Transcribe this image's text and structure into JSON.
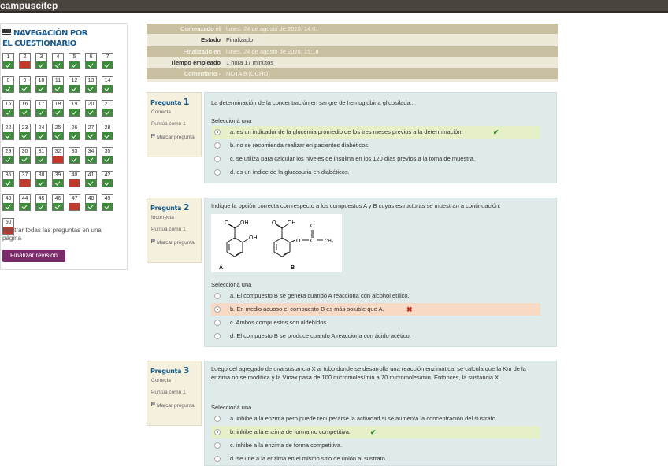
{
  "site": {
    "name": "campuscitep"
  },
  "nav": {
    "title": "NAVEGACIÓN POR EL CUESTIONARIO",
    "questions": [
      {
        "n": "1",
        "state": "ok"
      },
      {
        "n": "2",
        "state": "bad"
      },
      {
        "n": "3",
        "state": "ok"
      },
      {
        "n": "4",
        "state": "ok"
      },
      {
        "n": "5",
        "state": "ok"
      },
      {
        "n": "6",
        "state": "ok"
      },
      {
        "n": "7",
        "state": "ok"
      },
      {
        "n": "8",
        "state": "ok"
      },
      {
        "n": "9",
        "state": "ok"
      },
      {
        "n": "10",
        "state": "ok"
      },
      {
        "n": "11",
        "state": "ok"
      },
      {
        "n": "12",
        "state": "ok"
      },
      {
        "n": "13",
        "state": "ok"
      },
      {
        "n": "14",
        "state": "ok"
      },
      {
        "n": "15",
        "state": "ok"
      },
      {
        "n": "16",
        "state": "ok"
      },
      {
        "n": "17",
        "state": "ok"
      },
      {
        "n": "18",
        "state": "ok"
      },
      {
        "n": "19",
        "state": "ok"
      },
      {
        "n": "20",
        "state": "ok"
      },
      {
        "n": "21",
        "state": "ok"
      },
      {
        "n": "22",
        "state": "ok"
      },
      {
        "n": "23",
        "state": "ok"
      },
      {
        "n": "24",
        "state": "ok"
      },
      {
        "n": "25",
        "state": "ok"
      },
      {
        "n": "26",
        "state": "ok"
      },
      {
        "n": "27",
        "state": "ok"
      },
      {
        "n": "28",
        "state": "ok"
      },
      {
        "n": "29",
        "state": "ok"
      },
      {
        "n": "30",
        "state": "ok"
      },
      {
        "n": "31",
        "state": "ok"
      },
      {
        "n": "32",
        "state": "bad"
      },
      {
        "n": "33",
        "state": "ok"
      },
      {
        "n": "34",
        "state": "ok"
      },
      {
        "n": "35",
        "state": "ok"
      },
      {
        "n": "36",
        "state": "ok"
      },
      {
        "n": "37",
        "state": "bad"
      },
      {
        "n": "38",
        "state": "ok"
      },
      {
        "n": "39",
        "state": "ok"
      },
      {
        "n": "40",
        "state": "bad"
      },
      {
        "n": "41",
        "state": "ok"
      },
      {
        "n": "42",
        "state": "ok"
      },
      {
        "n": "43",
        "state": "ok"
      },
      {
        "n": "44",
        "state": "ok"
      },
      {
        "n": "45",
        "state": "ok"
      },
      {
        "n": "46",
        "state": "ok"
      },
      {
        "n": "47",
        "state": "bad"
      },
      {
        "n": "48",
        "state": "ok"
      },
      {
        "n": "49",
        "state": "ok"
      },
      {
        "n": "50",
        "state": "bad"
      }
    ],
    "show_all": "Mostrar todas las preguntas en una página",
    "finish": "Finalizar revisión"
  },
  "summary": {
    "started_label": "Comenzado el",
    "started_value": "lunes, 24 de agosto de 2020, 14:01",
    "state_label": "Estado",
    "state_value": "Finalizado",
    "finished_label": "Finalizado en",
    "finished_value": "lunes, 24 de agosto de 2020, 15:18",
    "time_label": "Tiempo empleado",
    "time_value": "1 hora 17 minutos",
    "comment_label": "Comentario -",
    "comment_value": "NOTA 8 (OCHO)"
  },
  "questions": [
    {
      "title": "Pregunta",
      "number": "1",
      "status": "Correcta",
      "points": "Puntúa como 1",
      "flag": "Marcar pregunta",
      "text": "La determinación de la concentración en sangre de hemoglobina glicosilada...",
      "prompt": "Seleccioná una",
      "answers": [
        {
          "text": "a. es un indicador de la glucemia promedio de los tres meses previos a la determinación."
        },
        {
          "text": "b. no se recomienda realizar en pacientes diabéticos."
        },
        {
          "text": "c. se utiliza para calcular los niveles de insulina en los 120 días previos a la toma de muestra."
        },
        {
          "text": "d. es un índice de la glucosuria en diabéticos."
        }
      ]
    },
    {
      "title": "Pregunta",
      "number": "2",
      "status": "Incorrecta",
      "points": "Puntúa como 1",
      "flag": "Marcar pregunta",
      "text": "Indique la opción correcta con respecto a los compuestos A y B cuyas estructuras se muestran a continuación:",
      "prompt": "Seleccioná una",
      "structures": {
        "label_a": "A",
        "label_b": "B",
        "oh": "OH",
        "o": "O",
        "ch3": "CH₃"
      },
      "answers": [
        {
          "text": "a. El compuesto B se genera cuando A reacciona con alcohol etílico."
        },
        {
          "text": "b. En medio acuoso el compuesto B es más soluble que A."
        },
        {
          "text": "c. Ambos compuestos son aldehídos."
        },
        {
          "text": "d. El compuesto B se produce cuando A reacciona con ácido acético."
        }
      ]
    },
    {
      "title": "Pregunta",
      "number": "3",
      "status": "Correcta",
      "points": "Puntúa como 1",
      "flag": "Marcar pregunta",
      "text": "Luego del agregado de una sustancia X al tubo donde se desarrolla una reacción enzimática, se calcula que la Km de la enzima no se modifica y la Vmax pasa de 100 micromoles/min a 70 micromoles/min. Entonces, la sustancia X",
      "prompt": "Seleccioná una",
      "answers": [
        {
          "text": "a. inhibe a la enzima pero puede recuperarse la actividad si se aumenta la concentración del sustrato."
        },
        {
          "text": "b. inhibe a la enzima de forma no competitiva."
        },
        {
          "text": "c. inhibe a la enzima de forma competitiva."
        },
        {
          "text": "d. se une a la enzima en el mismo sitio de unión al sustrato."
        }
      ]
    }
  ]
}
